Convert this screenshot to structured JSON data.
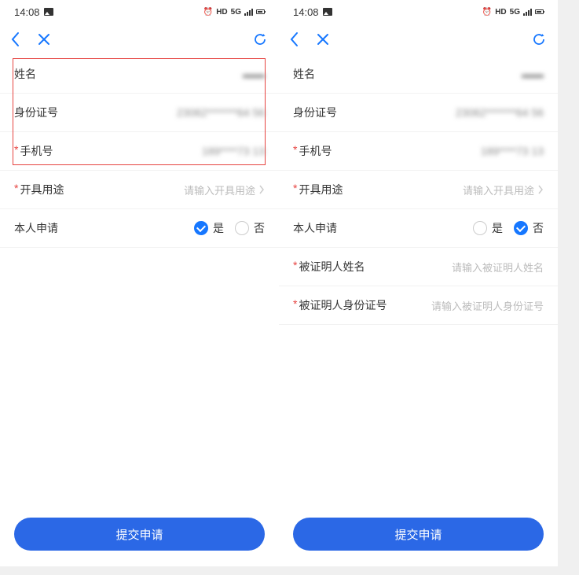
{
  "status": {
    "time": "14:08",
    "hd": "HD",
    "net": "5G"
  },
  "left": {
    "rows": [
      {
        "label": "姓名",
        "value": "▬▬",
        "required": false
      },
      {
        "label": "身份证号",
        "value": "23062*******64 56",
        "required": false
      },
      {
        "label": "手机号",
        "value": "189****73 13",
        "required": true
      }
    ],
    "purpose": {
      "label": "开具用途",
      "placeholder": "请输入开具用途"
    },
    "self_apply": {
      "label": "本人申请",
      "yes": "是",
      "no": "否",
      "selected": "yes"
    },
    "submit": "提交申请"
  },
  "right": {
    "rows": [
      {
        "label": "姓名",
        "value": "▬▬",
        "required": false
      },
      {
        "label": "身份证号",
        "value": "23062*******64 56",
        "required": false
      },
      {
        "label": "手机号",
        "value": "189****73 13",
        "required": true
      }
    ],
    "purpose": {
      "label": "开具用途",
      "placeholder": "请输入开具用途"
    },
    "self_apply": {
      "label": "本人申请",
      "yes": "是",
      "no": "否",
      "selected": "no"
    },
    "certified_name": {
      "label": "被证明人姓名",
      "placeholder": "请输入被证明人姓名"
    },
    "certified_id": {
      "label": "被证明人身份证号",
      "placeholder": "请输入被证明人身份证号"
    },
    "submit": "提交申请"
  }
}
